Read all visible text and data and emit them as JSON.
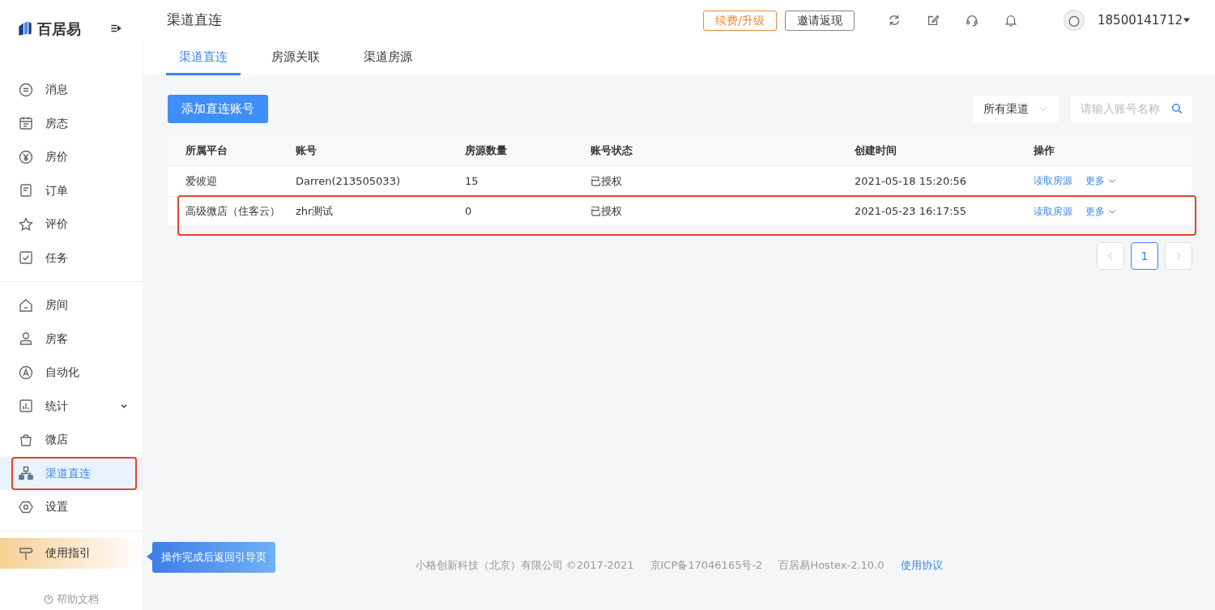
{
  "logo": {
    "text": "百居易"
  },
  "page_title": "渠道直连",
  "header_buttons": [
    {
      "label": "续费/升级",
      "kind": "warning"
    },
    {
      "label": "邀请返现",
      "kind": "plain"
    }
  ],
  "user": {
    "phone": "18500141712"
  },
  "sidebar": {
    "groups": [
      {
        "items": [
          {
            "label": "消息",
            "selected": false,
            "highlighted": false
          },
          {
            "label": "房态",
            "selected": false,
            "highlighted": false
          },
          {
            "label": "房价",
            "selected": false,
            "highlighted": false
          },
          {
            "label": "订单",
            "selected": false,
            "highlighted": false
          },
          {
            "label": "评价",
            "selected": false,
            "highlighted": false
          },
          {
            "label": "任务",
            "selected": false,
            "highlighted": false
          }
        ]
      },
      {
        "items": [
          {
            "label": "房间",
            "selected": false,
            "highlighted": false
          },
          {
            "label": "房客",
            "selected": false,
            "highlighted": false
          },
          {
            "label": "自动化",
            "selected": false,
            "highlighted": false
          },
          {
            "label": "统计",
            "selected": false,
            "highlighted": false,
            "expandable": true
          },
          {
            "label": "微店",
            "selected": false,
            "highlighted": false
          },
          {
            "label": "渠道直连",
            "selected": true,
            "highlighted": true
          },
          {
            "label": "设置",
            "selected": false,
            "highlighted": false
          }
        ]
      }
    ],
    "guide": "使用指引",
    "help": "帮助文档"
  },
  "tooltip": "操作完成后返回引导页",
  "tabs": [
    {
      "label": "渠道直连",
      "selected": true
    },
    {
      "label": "房源关联",
      "selected": false
    },
    {
      "label": "渠道房源",
      "selected": false
    }
  ],
  "add_button": "添加直连账号",
  "filter": {
    "value": "所有渠道"
  },
  "search": {
    "placeholder": "请输入账号名称"
  },
  "table": {
    "columns": [
      "所属平台",
      "账号",
      "房源数量",
      "账号状态",
      "创建时间",
      "操作"
    ],
    "rows": [
      {
        "cells": [
          "爱彼迎",
          "Darren(213505033)",
          "15",
          "已授权",
          "2021-05-18 15:20:56"
        ],
        "actions": [
          "读取房源",
          "更多"
        ],
        "highlighted": false
      },
      {
        "cells": [
          "高级微店（住客云）",
          "zhr测试",
          "0",
          "已授权",
          "2021-05-23 16:17:55"
        ],
        "actions": [
          "读取房源",
          "更多"
        ],
        "highlighted": true
      }
    ]
  },
  "pagination": {
    "pages": [
      {
        "label": "1",
        "selected": true
      }
    ]
  },
  "footer": {
    "texts": [
      "小格创新科技（北京）有限公司 ©2017-2021",
      "京ICP备17046165号-2",
      "百居易Hostex-2.10.0"
    ],
    "link": "使用协议"
  }
}
